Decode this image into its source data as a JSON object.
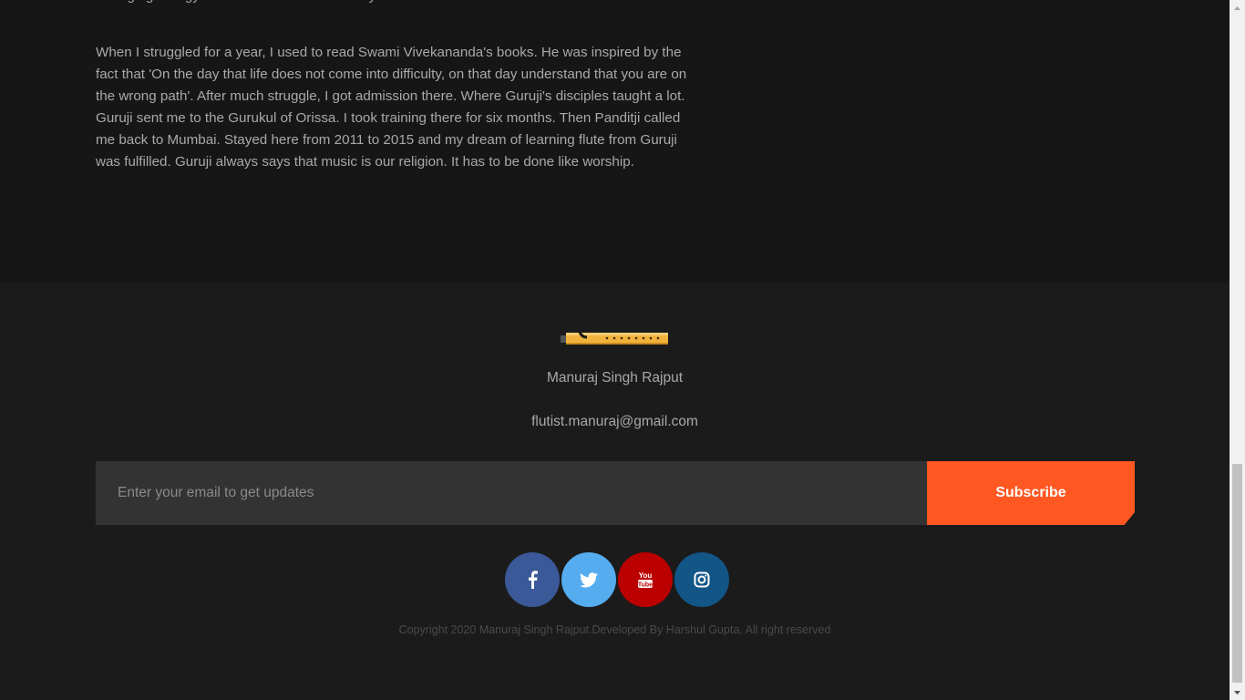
{
  "article": {
    "cut_line": "emerging energy and sound of the flute always",
    "paragraph": "When I struggled for a year, I used to read Swami Vivekananda's books. He was inspired by the fact that 'On the day that life does not come into difficulty, on that day understand that you are on the wrong path'. After much struggle, I got admission there. Where Guruji's disciples taught a lot. Guruji sent me to the Gurukul of Orissa. I took training there for six months. Then Panditji called me back to Mumbai. Stayed here from 2011 to 2015 and my dream of learning flute from Guruji was fulfilled. Guruji always says that music is our religion. It has to be done like worship."
  },
  "footer": {
    "logo_icon": "flute-icon",
    "name": "Manuraj Singh Rajput",
    "email": "flutist.manuraj@gmail.com",
    "subscribe": {
      "placeholder": "Enter your email to get updates",
      "value": "",
      "button_label": "Subscribe"
    },
    "social": [
      {
        "name": "facebook",
        "icon": "facebook-icon",
        "color": "#3b5998"
      },
      {
        "name": "twitter",
        "icon": "twitter-icon",
        "color": "#55acee"
      },
      {
        "name": "youtube",
        "icon": "youtube-icon",
        "color": "#bb0000"
      },
      {
        "name": "instagram",
        "icon": "instagram-icon",
        "color": "#125688"
      }
    ],
    "copyright": "Copyright 2020 Manuraj Singh Rajput.Developed By Harshul Gupta. All right reserved"
  },
  "colors": {
    "accent": "#ff5722",
    "background": "#161616",
    "footer_background": "#1b1b1b",
    "input_background": "#333333",
    "text": "#a9a9a9"
  }
}
